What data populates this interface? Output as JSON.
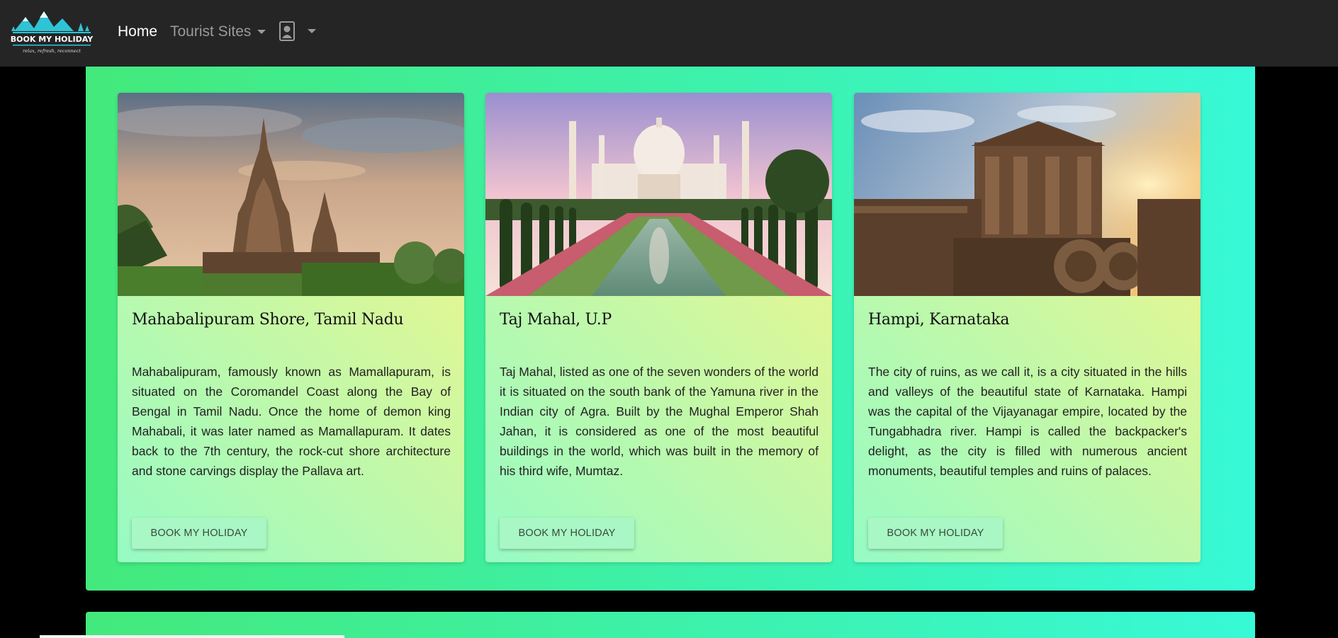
{
  "nav": {
    "brand_name": "BOOK MY HOLIDAY",
    "brand_tagline": "relax, refresh, reconnect",
    "home_label": "Home",
    "sites_label": "Tourist Sites",
    "user_icon": "user-portrait-icon"
  },
  "colors": {
    "navbar": "#252525",
    "section_gradient_start": "#43e97b",
    "section_gradient_end": "#38f9d7",
    "card_gradient_start": "#96fbc4",
    "card_gradient_end": "#f9f586"
  },
  "cards": [
    {
      "image": "mahabalipuram-shore-temple-photo",
      "title": "Mahabalipuram Shore, Tamil Nadu",
      "text": "Mahabalipuram, famously known as Mamallapuram, is situated on the Coromandel Coast along the Bay of Bengal in Tamil Nadu. Once the home of demon king Mahabali, it was later named as Mamallapuram. It dates back to the 7th century, the rock-cut shore architecture and stone carvings display the Pallava art.",
      "button": "BOOK MY HOLIDAY"
    },
    {
      "image": "taj-mahal-photo",
      "title": "Taj Mahal, U.P",
      "text": "Taj Mahal, listed as one of the seven wonders of the world it is situated on the south bank of the Yamuna river in the Indian city of Agra. Built by the Mughal Emperor Shah Jahan, it is considered as one of the most beautiful buildings in the world, which was built in the memory of his third wife, Mumtaz.",
      "button": "BOOK MY HOLIDAY"
    },
    {
      "image": "hampi-stone-chariot-photo",
      "title": "Hampi, Karnataka",
      "text": "The city of ruins, as we call it, is a city situated in the hills and valleys of the beautiful state of Karnataka. Hampi was the capital of the Vijayanagar empire, located by the Tungabhadra river. Hampi is called the backpacker's delight, as the city is filled with numerous ancient monuments, beautiful temples and ruins of palaces.",
      "button": "BOOK MY HOLIDAY"
    }
  ]
}
